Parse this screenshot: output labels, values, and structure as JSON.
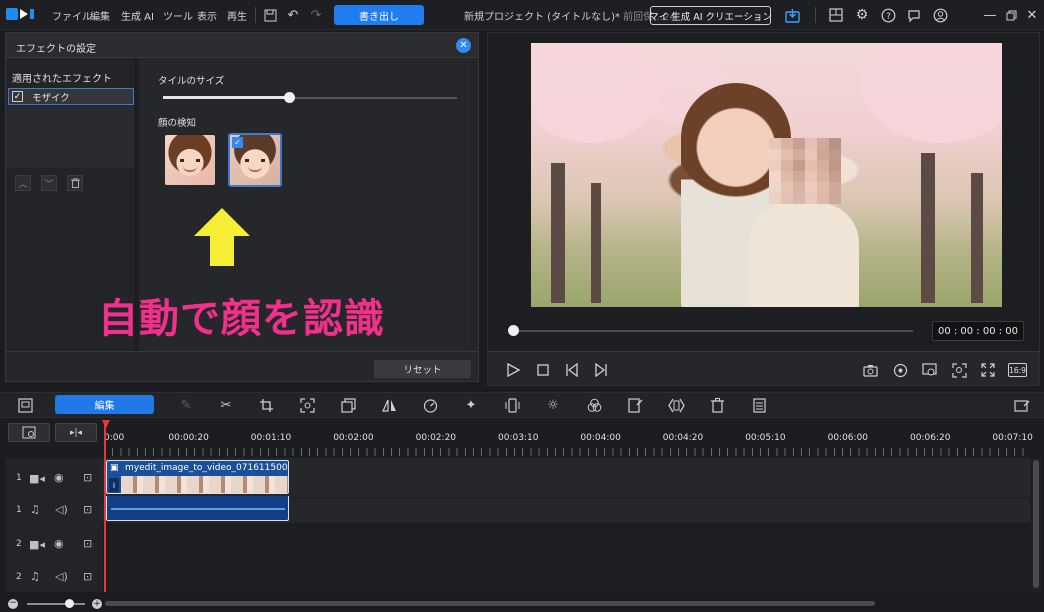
{
  "titlebar": {
    "menu": [
      "ファイル",
      "編集",
      "生成 AI",
      "ツール",
      "表示",
      "再生"
    ],
    "export_label": "書き出し",
    "project_title": "新規プロジェクト (タイトルなし)*",
    "project_saved": "前回保…24",
    "ai_creation_label": "マイ 生成 AI クリエーション"
  },
  "effect_panel": {
    "title": "エフェクトの設定",
    "applied_label": "適用されたエフェクト",
    "applied_items": [
      "モザイク"
    ],
    "tile_size_label": "タイルのサイズ",
    "tile_size_value": 0.43,
    "face_detection_label": "顔の検知",
    "annotation": "自動で顔を認識",
    "reset_label": "リセット"
  },
  "preview": {
    "timecode": "00 : 00 : 00 : 00",
    "aspect": "16:9"
  },
  "toolbar": {
    "edit_tab": "編集"
  },
  "timeline": {
    "ruler": [
      "0:00",
      "00:00:20",
      "00:01:10",
      "00:02:00",
      "00:02:20",
      "00:03:10",
      "00:04:00",
      "00:04:20",
      "00:05:10",
      "00:06:00",
      "00:06:20",
      "00:07:10"
    ],
    "tracks": [
      {
        "num": "1",
        "type": "video"
      },
      {
        "num": "1",
        "type": "audio"
      },
      {
        "num": "2",
        "type": "video"
      },
      {
        "num": "2",
        "type": "audio"
      }
    ],
    "clip_name": "myedit_image_to_video_0716115004"
  },
  "colors": {
    "accent": "#2179e8",
    "annotation": "#f0308a",
    "playhead": "#e23a3a"
  }
}
